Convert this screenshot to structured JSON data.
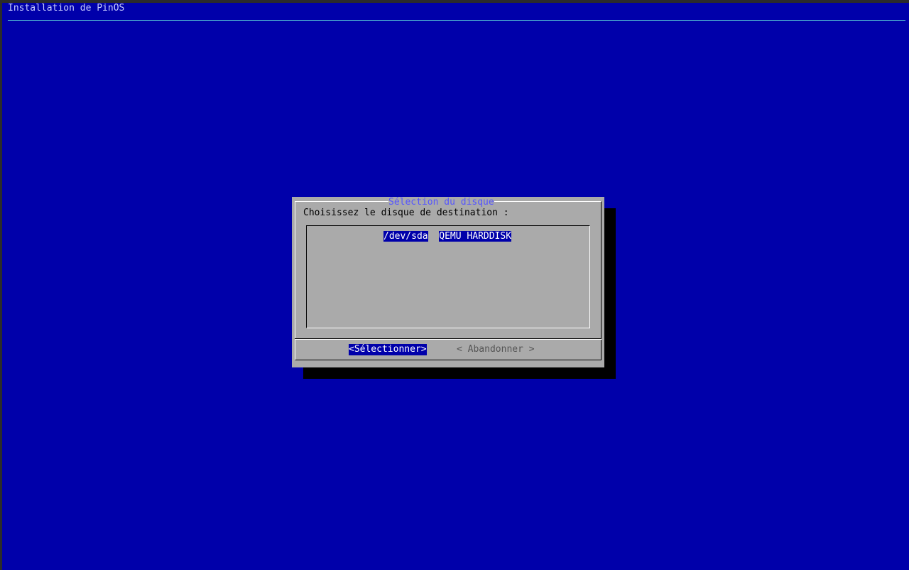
{
  "backtitle": "Installation de PinOS",
  "dialog": {
    "title": "Sélection du disque",
    "prompt": "Choisissez le disque de destination :",
    "items": [
      {
        "tag": "/dev/sda",
        "description": "QEMU HARDDISK"
      }
    ],
    "buttons": {
      "select_label": "<Sélectionner>",
      "cancel_label": "< Abandonner >"
    }
  },
  "colors": {
    "background": "#0000aa",
    "dialog": "#aaaaaa",
    "highlight": "#0000aa",
    "title": "#5555ff"
  }
}
